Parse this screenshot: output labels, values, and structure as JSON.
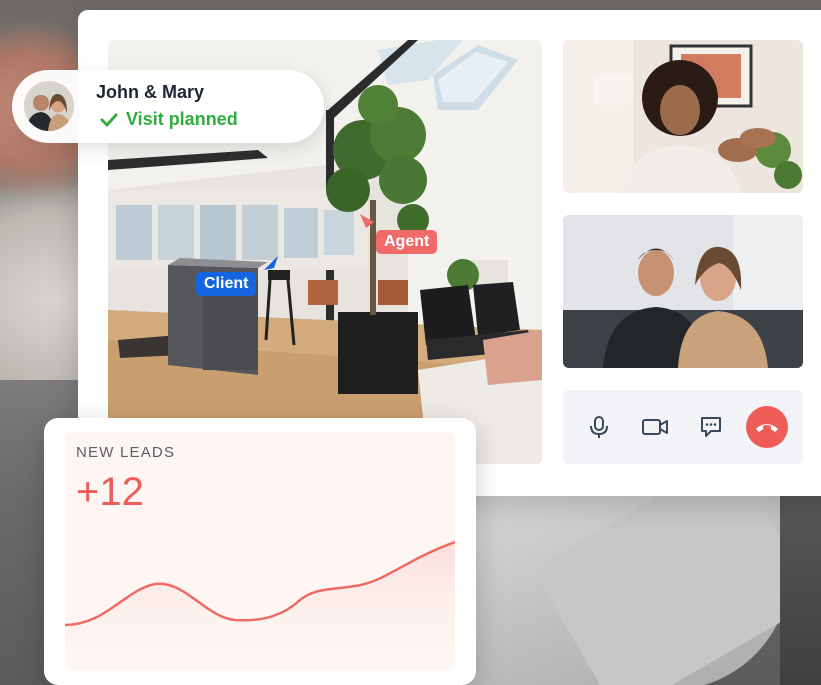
{
  "visit_badge": {
    "name": "John & Mary",
    "status": "Visit planned",
    "status_icon": "check-icon"
  },
  "room": {
    "client_label": "Client",
    "agent_label": "Agent"
  },
  "call_controls": [
    {
      "id": "microphone",
      "icon": "microphone-icon"
    },
    {
      "id": "camera",
      "icon": "video-camera-icon"
    },
    {
      "id": "chat",
      "icon": "chat-icon"
    },
    {
      "id": "end-call",
      "icon": "hang-up-icon"
    }
  ],
  "leads": {
    "label": "NEW LEADS",
    "value": "+12"
  },
  "colors": {
    "accent": "#ef5d59",
    "client_tag": "#1565e0",
    "agent_tag": "#f06a6a",
    "status_green": "#2fae3c"
  }
}
